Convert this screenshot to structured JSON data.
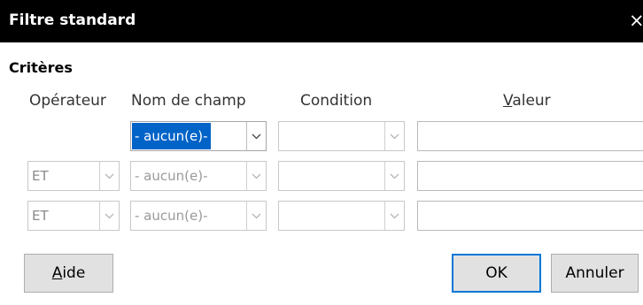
{
  "window": {
    "title": "Filtre standard",
    "close_glyph": "×"
  },
  "criteria": {
    "section_title": "Critères",
    "headers": {
      "operator": "Opérateur",
      "field_name": "Nom de champ",
      "condition": "Condition",
      "value_prefix": "V",
      "value_rest": "aleur"
    },
    "rows": [
      {
        "operator": "",
        "field": "- aucun(e)-",
        "condition": "",
        "value": ""
      },
      {
        "operator": "ET",
        "field": "- aucun(e)-",
        "condition": "",
        "value": ""
      },
      {
        "operator": "ET",
        "field": "- aucun(e)-",
        "condition": "",
        "value": ""
      }
    ]
  },
  "buttons": {
    "help_mnemonic": "A",
    "help_rest": "ide",
    "ok": "OK",
    "cancel": "Annuler"
  },
  "colors": {
    "selection": "#0063c7",
    "default_button_border": "#0078d7"
  }
}
